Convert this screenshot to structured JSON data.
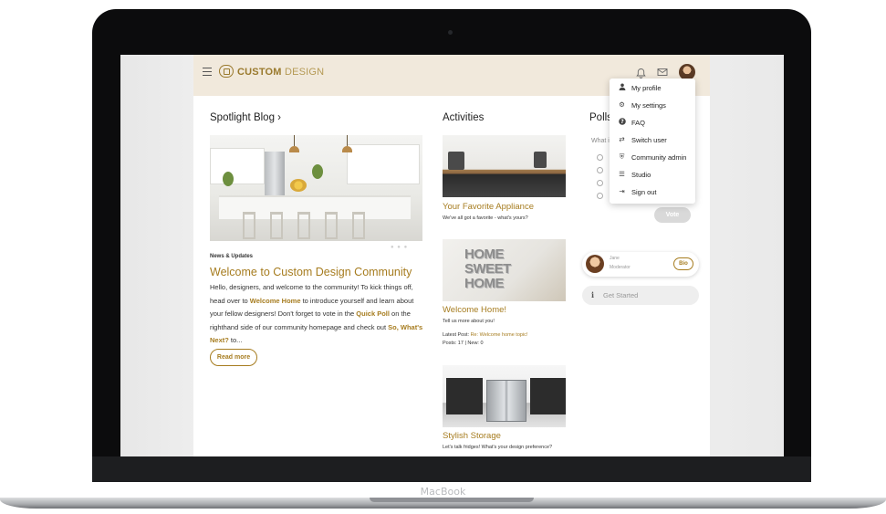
{
  "device": {
    "brand": "MacBook"
  },
  "header": {
    "logo_bold": "CUSTOM",
    "logo_light": "DESIGN"
  },
  "spotlight": {
    "title": "Spotlight Blog",
    "chevron": "›",
    "carousel_dots": "● ● ●",
    "post": {
      "tag": "News & Updates",
      "title": "Welcome to Custom Design Community",
      "body_1": "Hello, designers, and welcome to the community! To kick things off, head over to ",
      "link_1": "Welcome Home",
      "body_2": " to introduce yourself and learn about your fellow designers! Don't forget to vote in the ",
      "link_2": "Quick Poll",
      "body_3": " on the righthand side of our community homepage and check out ",
      "link_3": "So, What's Next?",
      "body_4": " to...",
      "read_more": "Read more"
    }
  },
  "activities": {
    "title": "Activities",
    "items": [
      {
        "title": "Your Favorite Appliance",
        "desc": "We've all got a favorite - what's yours?"
      },
      {
        "title": "Welcome Home!",
        "desc": "Tell us more about you!",
        "latest_label": "Latest Post: ",
        "latest_link": "Re: Welcome home topic!",
        "stats": "Posts: 17 | New: 0",
        "image_words": [
          "HOME",
          "SWEET",
          "HOME"
        ]
      },
      {
        "title": "Stylish Storage",
        "desc": "Let's talk fridges! What's your design preference?"
      }
    ]
  },
  "polls": {
    "title": "Polls",
    "question": "What i",
    "vote_label": "Vote"
  },
  "user_card": {
    "name": "Jane",
    "role": "Moderator",
    "bio_label": "Bio"
  },
  "get_started": {
    "label": "Get Started"
  },
  "user_menu": {
    "items": [
      {
        "label": "My profile",
        "icon": "user-icon",
        "glyph": "👤"
      },
      {
        "label": "My settings",
        "icon": "gear-icon",
        "glyph": "⚙"
      },
      {
        "label": "FAQ",
        "icon": "question-icon",
        "glyph": "?"
      },
      {
        "label": "Switch user",
        "icon": "switch-user-icon",
        "glyph": "⇄"
      },
      {
        "label": "Community admin",
        "icon": "shield-icon",
        "glyph": "⛨"
      },
      {
        "label": "Studio",
        "icon": "sliders-icon",
        "glyph": "☰"
      },
      {
        "label": "Sign out",
        "icon": "sign-out-icon",
        "glyph": "⇥"
      }
    ]
  },
  "icons": {
    "bell": "bell-icon",
    "mail": "mail-icon"
  },
  "colors": {
    "accent": "#a67c1f",
    "header_bg": "#f1e9dc"
  }
}
